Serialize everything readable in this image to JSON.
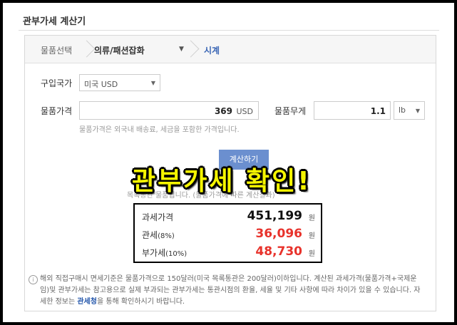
{
  "title": "관부가세 계산기",
  "crumbs": {
    "step1": "물품선택",
    "step2": "의류/패션잡화",
    "step3": "시계"
  },
  "country": {
    "label": "구입국가",
    "value": "미국 USD"
  },
  "price": {
    "label": "물품가격",
    "value": "369",
    "unit": "USD",
    "hint": "물품가격은 외국내 배송료, 세금을 포함한 가격입니다."
  },
  "weight": {
    "label": "물품무게",
    "value": "1.1",
    "unit": "lb"
  },
  "calculate_button": "계산하기",
  "dim_note": "목록통관 물품입니다. (물품가격에 따른 계산결과)",
  "overlay_caption": "관부가세 확인!",
  "result": {
    "rows": [
      {
        "label": "과세가격",
        "sub": "",
        "value": "451,199",
        "unit": "원",
        "color": "#111111"
      },
      {
        "label": "관세",
        "sub": "(8%)",
        "value": "36,096",
        "unit": "원",
        "color": "#e8322b"
      },
      {
        "label": "부가세",
        "sub": "(10%)",
        "value": "48,730",
        "unit": "원",
        "color": "#e8322b"
      }
    ]
  },
  "notice": {
    "icon": "info-icon",
    "text_before": "해외 직접구매시 면세기준은 물품가격으로 150달러(미국 목록통관은 200달러)이하입니다. 계산된 과세가격(물품가격+국제운임)및 관부가세는 참고용으로 실제 부과되는 관부가세는 통관시점의 환율, 세율 및 기타 사항에 따라 차이가 있을 수 있습니다. 자세한 정보는 ",
    "link": "관세청",
    "text_after": "을 통해 확인하시기 바랍니다."
  }
}
